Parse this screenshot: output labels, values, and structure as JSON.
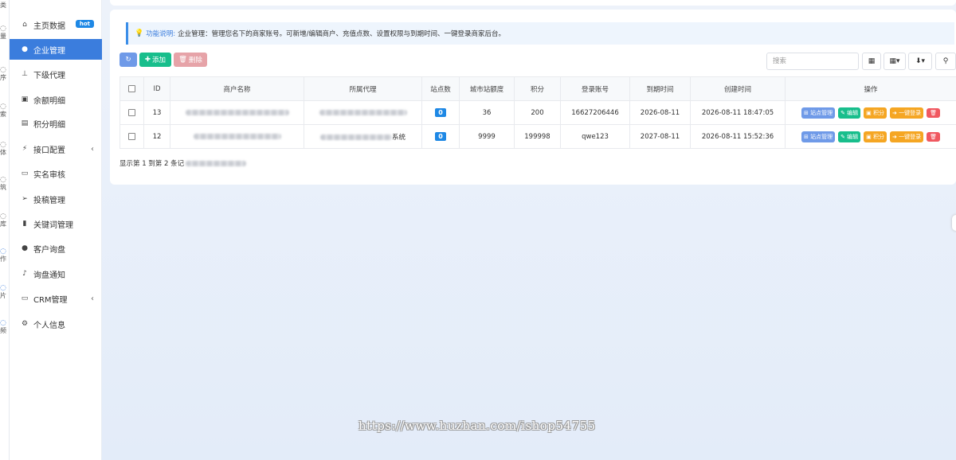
{
  "left_strip": [
    {
      "char": "类"
    },
    {
      "char": "量"
    },
    {
      "char": "序"
    },
    {
      "char": "索"
    },
    {
      "char": "体"
    },
    {
      "char": "筑"
    },
    {
      "char": "库"
    },
    {
      "char": "作"
    },
    {
      "char": "片"
    },
    {
      "char": "频"
    }
  ],
  "sidebar": {
    "items": [
      {
        "label": "主页数据",
        "icon": "home-icon",
        "badge": "hot"
      },
      {
        "label": "企业管理",
        "icon": "user-circle-icon",
        "active": true
      },
      {
        "label": "下级代理",
        "icon": "sitemap-icon"
      },
      {
        "label": "余额明细",
        "icon": "money-icon"
      },
      {
        "label": "积分明细",
        "icon": "list-icon"
      },
      {
        "label": "接口配置",
        "icon": "plug-icon",
        "has_children": true
      },
      {
        "label": "实名审核",
        "icon": "id-card-icon"
      },
      {
        "label": "投稿管理",
        "icon": "paper-plane-icon"
      },
      {
        "label": "关键词管理",
        "icon": "book-icon"
      },
      {
        "label": "客户询盘",
        "icon": "comments-icon"
      },
      {
        "label": "询盘通知",
        "icon": "bell-icon"
      },
      {
        "label": "CRM管理",
        "icon": "address-card-icon",
        "has_children": true
      },
      {
        "label": "个人信息",
        "icon": "gear-icon"
      }
    ],
    "active_color": "#3b7ddd"
  },
  "notice": {
    "title": "功能说明:",
    "text": "企业管理：管理您名下的商家账号。可新增/编辑商户、充值点数、设置权限与到期时间、一键登录商家后台。"
  },
  "toolbar": {
    "add_label": "添加",
    "delete_label": "删除",
    "search_placeholder": "搜索"
  },
  "table": {
    "headers": [
      "ID",
      "商户名称",
      "所属代理",
      "站点数",
      "城市站额度",
      "积分",
      "登录账号",
      "到期时间",
      "创建时间",
      "操作"
    ],
    "rows": [
      {
        "id": "13",
        "agent_suffix": "",
        "sites": "0",
        "city_quota": "36",
        "points": "200",
        "account": "16627206446",
        "expire": "2026-08-11",
        "created": "2026-08-11 18:47:05"
      },
      {
        "id": "12",
        "agent_suffix": "系统",
        "sites": "0",
        "city_quota": "9999",
        "points": "199998",
        "account": "qwe123",
        "expire": "2027-08-11",
        "created": "2026-08-11 15:52:36"
      }
    ],
    "actions": {
      "site": "站点管理",
      "edit": "编辑",
      "points": "积分",
      "login": "一键登录"
    }
  },
  "pagination_info": "显示第 1 到第 2 条记",
  "watermark": "https://www.huzhan.com/ishop54755",
  "colors": {
    "primary": "#3b7ddd",
    "success": "#18be8c",
    "warning": "#f5a623",
    "danger": "#f05860"
  }
}
